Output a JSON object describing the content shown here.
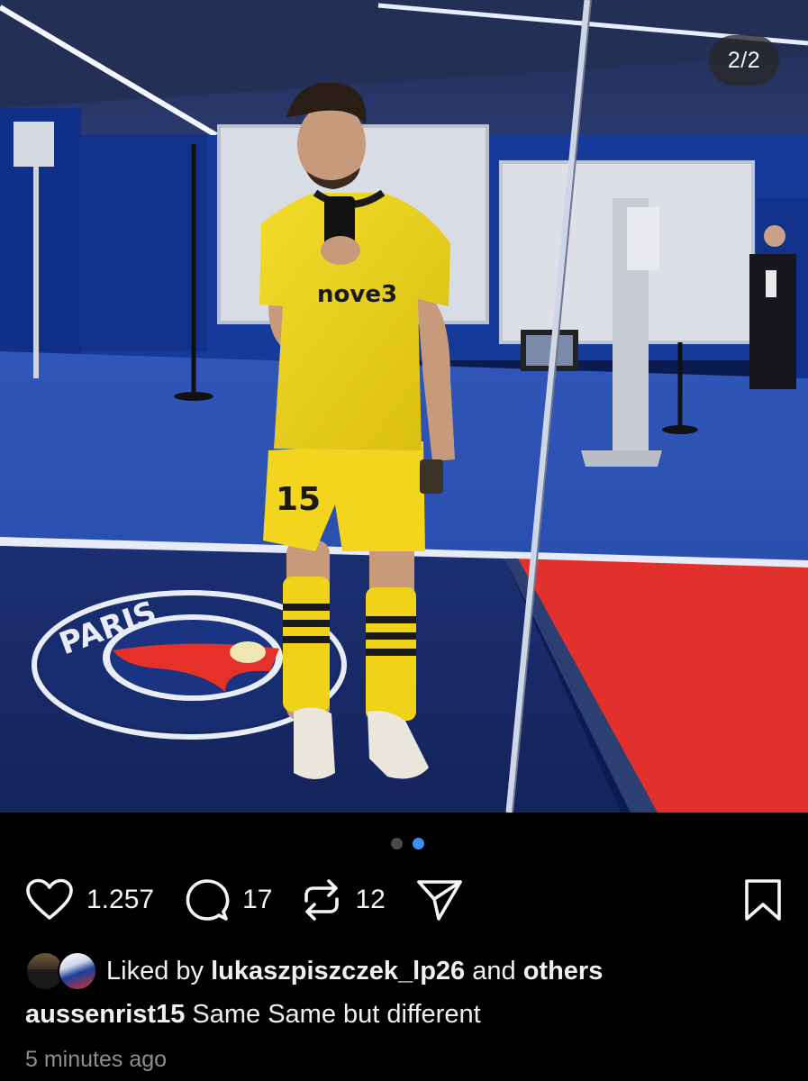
{
  "photo": {
    "counter": "2/2",
    "alt_subject": "mirror-selfie"
  },
  "pagination": {
    "total": 2,
    "active_index": 1
  },
  "actions": {
    "like_count": "1.257",
    "comment_count": "17",
    "repost_count": "12"
  },
  "liked_by": {
    "prefix": "Liked by",
    "user": "lukaszpiszczek_lp26",
    "conjunction": "and",
    "others": "others"
  },
  "caption": {
    "username": "aussenrist15",
    "text": "Same Same but different"
  },
  "timestamp": "5 minutes ago",
  "colors": {
    "background": "#000000",
    "dot_active": "#3f8ff2",
    "dot_inactive": "#4b4b4b",
    "muted_text": "#8e8e8e"
  }
}
